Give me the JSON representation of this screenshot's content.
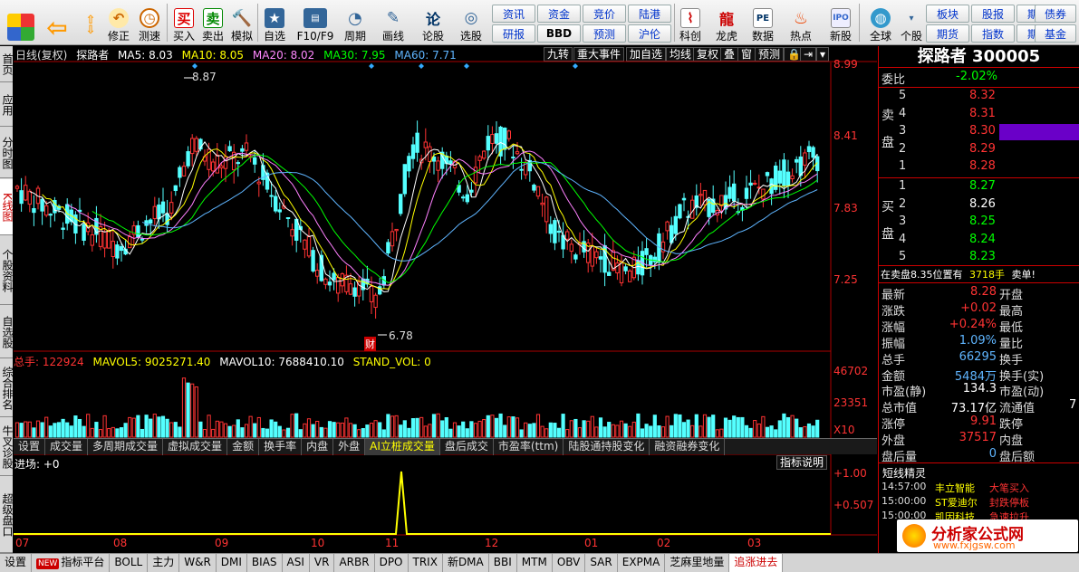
{
  "toolbar": {
    "buttons": [
      {
        "label": "修正",
        "icon": "undo-icon"
      },
      {
        "label": "测速",
        "icon": "clock-icon"
      },
      {
        "label": "买入",
        "icon": "buy-icon"
      },
      {
        "label": "卖出",
        "icon": "sell-icon"
      },
      {
        "label": "模拟",
        "icon": "hammer-icon"
      },
      {
        "label": "自选",
        "icon": "folder-star-icon"
      },
      {
        "label": "F10/F9",
        "icon": "f10-icon"
      },
      {
        "label": "周期",
        "icon": "period-icon"
      },
      {
        "label": "画线",
        "icon": "pencil-icon"
      },
      {
        "label": "论股",
        "icon": "discuss-icon"
      },
      {
        "label": "选股",
        "icon": "stock-pick-icon"
      },
      {
        "label": "科创",
        "icon": "chart-icon"
      },
      {
        "label": "龙虎",
        "icon": "dragon-icon"
      },
      {
        "label": "数据",
        "icon": "pe-icon"
      },
      {
        "label": "热点",
        "icon": "fire-icon"
      },
      {
        "label": "新股",
        "icon": "ipo-icon"
      },
      {
        "label": "全球",
        "icon": "globe-icon"
      },
      {
        "label": "个股",
        "icon": "dropdown-icon"
      }
    ],
    "small_buttons": [
      "资讯",
      "资金",
      "竞价",
      "陆港",
      "研报",
      "BBD",
      "预测",
      "沪伦",
      "板块",
      "股报",
      "期权",
      "债券",
      "期货",
      "指数",
      "期货",
      "基金"
    ]
  },
  "left_tabs": [
    "首页",
    "应用",
    "分时图",
    "K线图",
    "个股资料",
    "自选股",
    "综合排名",
    "牛叉诊股",
    "超级盘口"
  ],
  "kline": {
    "header": {
      "period": "日线(复权)",
      "name": "探路者",
      "ma5": "MA5: 8.03",
      "ma10": "MA10: 8.05",
      "ma20": "MA20: 8.02",
      "ma30": "MA30: 7.95",
      "ma60": "MA60: 7.71"
    },
    "tools": [
      "九转",
      "重大事件",
      "加自选",
      "均线",
      "复权",
      "叠",
      "窗",
      "预测"
    ],
    "price_axis": [
      "8.99",
      "8.41",
      "7.83",
      "7.25"
    ],
    "high_label": "8.87",
    "low_label": "6.78",
    "marker": "财"
  },
  "volume": {
    "header": {
      "total": "总手: 122924",
      "mavol5": "MAVOL5: 9025271.40",
      "mavol10": "MAVOL10: 7688410.10",
      "stand": "STAND_VOL: 0"
    },
    "axis": [
      "46702",
      "23351",
      "X10"
    ],
    "tabs": [
      "设置",
      "成交量",
      "多周期成交量",
      "虚拟成交量",
      "金额",
      "换手率",
      "内盘",
      "外盘",
      "AI立桩成交量",
      "盘后成交",
      "市盈率(ttm)",
      "陆股通持股变化",
      "融资融券变化"
    ]
  },
  "indicator": {
    "header": "进场: +0",
    "explain": "指标说明",
    "axis": [
      "+1.00",
      "+0.507"
    ]
  },
  "months": [
    "07",
    "08",
    "09",
    "10",
    "11",
    "12",
    "01",
    "02",
    "03"
  ],
  "bottom_tabs": [
    "设置",
    "指标平台",
    "BOLL",
    "主力",
    "W&R",
    "DMI",
    "BIAS",
    "ASI",
    "VR",
    "ARBR",
    "DPO",
    "TRIX",
    "新DMA",
    "BBI",
    "MTM",
    "OBV",
    "SAR",
    "EXPMA",
    "芝麻里地量",
    "追涨进去"
  ],
  "bottom_new_tag": "NEW",
  "quote": {
    "title": "探路者 300005",
    "weibi_label": "委比",
    "weibi_value": "-2.02%",
    "sell_label": "卖盘",
    "buy_label": "买盘",
    "sell": [
      {
        "n": "5",
        "price": "8.32"
      },
      {
        "n": "4",
        "price": "8.31"
      },
      {
        "n": "3",
        "price": "8.30"
      },
      {
        "n": "2",
        "price": "8.29"
      },
      {
        "n": "1",
        "price": "8.28"
      }
    ],
    "buy": [
      {
        "n": "1",
        "price": "8.27"
      },
      {
        "n": "2",
        "price": "8.26"
      },
      {
        "n": "3",
        "price": "8.25"
      },
      {
        "n": "4",
        "price": "8.24"
      },
      {
        "n": "5",
        "price": "8.23"
      }
    ],
    "status": "在卖盘8.35位置有",
    "status_vol": "3718手",
    "status_tail": "卖单!",
    "stats": [
      {
        "l": "最新",
        "v": "8.28",
        "l2": "开盘",
        "v2": ""
      },
      {
        "l": "涨跌",
        "v": "+0.02",
        "l2": "最高",
        "v2": ""
      },
      {
        "l": "涨幅",
        "v": "+0.24%",
        "l2": "最低",
        "v2": ""
      },
      {
        "l": "振幅",
        "v": "1.09%",
        "l2": "量比",
        "v2": ""
      },
      {
        "l": "总手",
        "v": "66295",
        "l2": "换手",
        "v2": ""
      },
      {
        "l": "金额",
        "v": "5484万",
        "l2": "换手(实)",
        "v2": ""
      },
      {
        "l": "市盈(静)",
        "v": "134.3",
        "l2": "市盈(动)",
        "v2": ""
      },
      {
        "l": "总市值",
        "v": "73.17亿",
        "l2": "流通值",
        "v2": "7"
      },
      {
        "l": "涨停",
        "v": "9.91",
        "l2": "跌停",
        "v2": ""
      },
      {
        "l": "外盘",
        "v": "37517",
        "l2": "内盘",
        "v2": ""
      },
      {
        "l": "盘后量",
        "v": "0",
        "l2": "盘后额",
        "v2": ""
      }
    ],
    "news_title": "短线精灵",
    "news": [
      {
        "time": "14:57:00",
        "name": "丰立智能",
        "event": "大笔买入"
      },
      {
        "time": "15:00:00",
        "name": "ST爱迪尔",
        "event": "封跌停板"
      },
      {
        "time": "15:00:00",
        "name": "凯因科技",
        "event": "急速拉升"
      }
    ]
  },
  "watermark": {
    "text": "分析家公式网",
    "url": "www.fxjgsw.com"
  },
  "colors": {
    "up": "#ff3333",
    "down": "#54ffff",
    "ma5": "#ffffff",
    "ma10": "#ffff00",
    "ma20": "#ff80ff",
    "ma30": "#00ff00",
    "ma60": "#5fb5ff"
  }
}
